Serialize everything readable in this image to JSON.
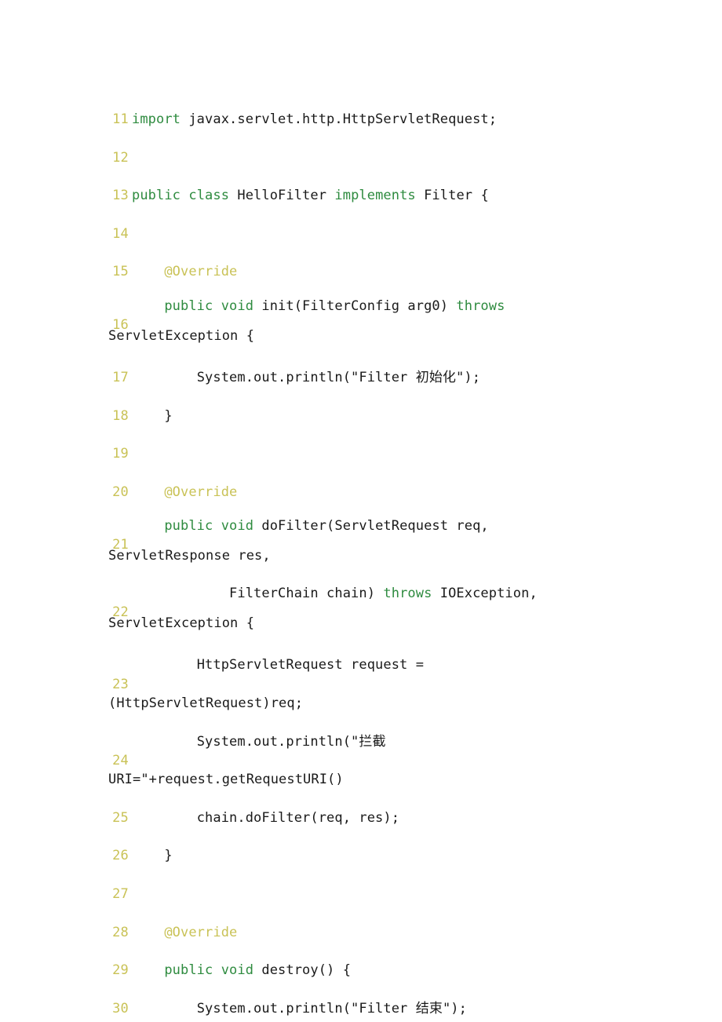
{
  "document": {
    "type": "source-code-listing",
    "language": "Java",
    "class_name": "HelloFilter",
    "background_color": "#ffffff",
    "colors": {
      "line_number": "#c9c256",
      "keyword": "#2e8b3f",
      "annotation": "#c9c256",
      "plain_text": "#1a1a1a",
      "page_background": "#ffffff"
    },
    "first_line_number": 11,
    "last_line_number": 30
  },
  "lines": [
    {
      "number": "11",
      "wrapped": false,
      "text": "import javax.servlet.http.HttpServletRequest;",
      "tokens": [
        {
          "t": "import",
          "c": "kw"
        },
        {
          "t": " javax.servlet.http.HttpServletRequest;",
          "c": "txt"
        }
      ]
    },
    {
      "number": "12",
      "wrapped": false,
      "text": "",
      "tokens": []
    },
    {
      "number": "13",
      "wrapped": false,
      "text": "public class HelloFilter implements Filter {",
      "tokens": [
        {
          "t": "public",
          "c": "kw"
        },
        {
          "t": " ",
          "c": "txt"
        },
        {
          "t": "class",
          "c": "kw"
        },
        {
          "t": " HelloFilter ",
          "c": "txt"
        },
        {
          "t": "implements",
          "c": "kw"
        },
        {
          "t": " Filter {",
          "c": "txt"
        }
      ]
    },
    {
      "number": "14",
      "wrapped": false,
      "text": "",
      "tokens": []
    },
    {
      "number": "15",
      "wrapped": false,
      "text": "    @Override",
      "tokens": [
        {
          "t": "    ",
          "c": "txt"
        },
        {
          "t": "@Override",
          "c": "ann"
        }
      ]
    },
    {
      "number": "16",
      "wrapped": true,
      "text": "    public void init(FilterConfig arg0) throws ServletException {",
      "tokens": [
        {
          "t": "    ",
          "c": "txt"
        },
        {
          "t": "public",
          "c": "kw"
        },
        {
          "t": " ",
          "c": "txt"
        },
        {
          "t": "void",
          "c": "kw"
        },
        {
          "t": " init(FilterConfig arg0) ",
          "c": "txt"
        },
        {
          "t": "throws",
          "c": "kw"
        },
        {
          "t": " ServletException {",
          "c": "txt"
        }
      ]
    },
    {
      "number": "17",
      "wrapped": false,
      "text": "        System.out.println(\"Filter 初始化\");",
      "tokens": [
        {
          "t": "        System.out.println(\"Filter ",
          "c": "txt"
        },
        {
          "t": "初始化",
          "c": "cjk"
        },
        {
          "t": "\");",
          "c": "txt"
        }
      ]
    },
    {
      "number": "18",
      "wrapped": false,
      "text": "    }",
      "tokens": [
        {
          "t": "    }",
          "c": "txt"
        }
      ]
    },
    {
      "number": "19",
      "wrapped": false,
      "text": "",
      "tokens": []
    },
    {
      "number": "20",
      "wrapped": false,
      "text": "    @Override",
      "tokens": [
        {
          "t": "    ",
          "c": "txt"
        },
        {
          "t": "@Override",
          "c": "ann"
        }
      ]
    },
    {
      "number": "21",
      "wrapped": true,
      "text": "    public void doFilter(ServletRequest req, ServletResponse res,",
      "tokens": [
        {
          "t": "    ",
          "c": "txt"
        },
        {
          "t": "public",
          "c": "kw"
        },
        {
          "t": " ",
          "c": "txt"
        },
        {
          "t": "void",
          "c": "kw"
        },
        {
          "t": " doFilter(ServletRequest req, ServletResponse res,",
          "c": "txt"
        }
      ]
    },
    {
      "number": "22",
      "wrapped": true,
      "text": "            FilterChain chain) throws IOException, ServletException {",
      "tokens": [
        {
          "t": "            FilterChain chain) ",
          "c": "txt"
        },
        {
          "t": "throws",
          "c": "kw"
        },
        {
          "t": " IOException, ServletException {",
          "c": "txt"
        }
      ]
    },
    {
      "number": "23",
      "wrapped": false,
      "text": "        HttpServletRequest request = (HttpServletRequest)req;",
      "tokens": [
        {
          "t": "        HttpServletRequest request = (HttpServletRequest)req;",
          "c": "txt"
        }
      ]
    },
    {
      "number": "24",
      "wrapped": false,
      "text": "        System.out.println(\"拦截 URI=\"+request.getRequestURI()",
      "tokens": [
        {
          "t": "        System.out.println(\"",
          "c": "txt"
        },
        {
          "t": "拦截",
          "c": "cjk"
        },
        {
          "t": " URI=\"+request.getRequestURI()",
          "c": "txt"
        }
      ]
    },
    {
      "number": "25",
      "wrapped": false,
      "text": "        chain.doFilter(req, res);",
      "tokens": [
        {
          "t": "        chain.doFilter(req, res);",
          "c": "txt"
        }
      ]
    },
    {
      "number": "26",
      "wrapped": false,
      "text": "    }",
      "tokens": [
        {
          "t": "    }",
          "c": "txt"
        }
      ]
    },
    {
      "number": "27",
      "wrapped": false,
      "text": "",
      "tokens": []
    },
    {
      "number": "28",
      "wrapped": false,
      "text": "    @Override",
      "tokens": [
        {
          "t": "    ",
          "c": "txt"
        },
        {
          "t": "@Override",
          "c": "ann"
        }
      ]
    },
    {
      "number": "29",
      "wrapped": false,
      "text": "    public void destroy() {",
      "tokens": [
        {
          "t": "    ",
          "c": "txt"
        },
        {
          "t": "public",
          "c": "kw"
        },
        {
          "t": " ",
          "c": "txt"
        },
        {
          "t": "void",
          "c": "kw"
        },
        {
          "t": " destroy() {",
          "c": "txt"
        }
      ]
    },
    {
      "number": "30",
      "wrapped": false,
      "text": "        System.out.println(\"Filter 结束\");",
      "tokens": [
        {
          "t": "        System.out.println(\"Filter ",
          "c": "txt"
        },
        {
          "t": "结束",
          "c": "cjk"
        },
        {
          "t": "\");",
          "c": "txt"
        }
      ]
    }
  ]
}
